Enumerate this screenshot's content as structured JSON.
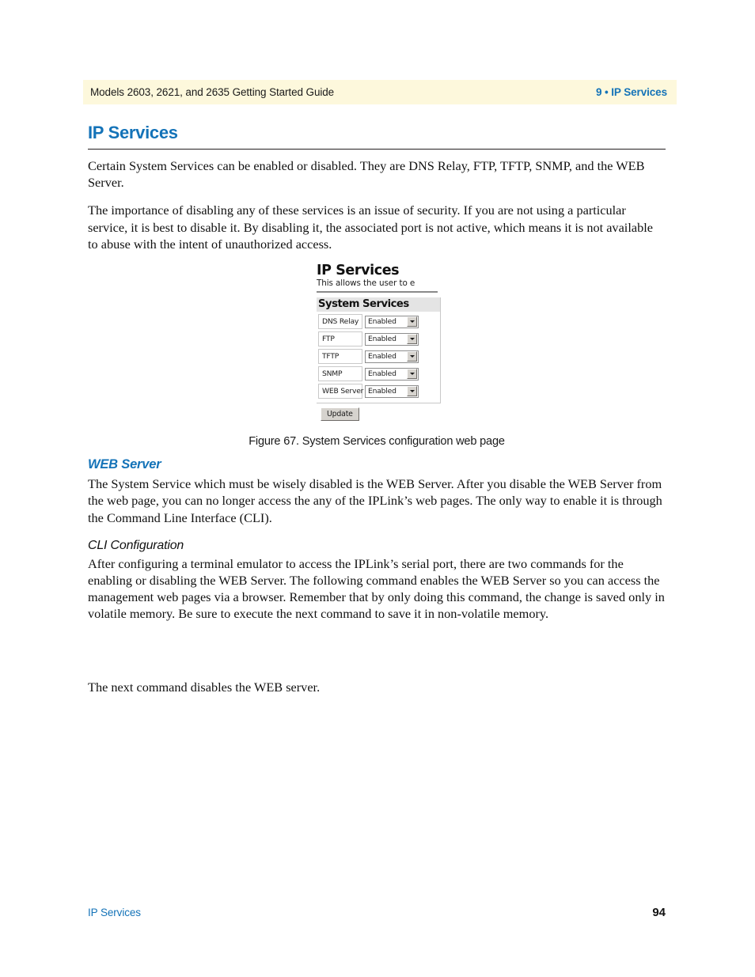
{
  "header": {
    "left_text": "Models 2603, 2621, and 2635 Getting Started Guide",
    "right_text": "9 • IP Services",
    "band_color": "#fdf8dc",
    "accent_color": "#1473b8"
  },
  "page": {
    "title": "IP Services",
    "paragraphs": [
      "Certain System Services can be enabled or disabled. They are DNS Relay, FTP, TFTP, SNMP, and the WEB Server.",
      "The importance of disabling any of these services is an issue of security. If you are not using a particular service, it is best to disable it. By disabling it, the associated port is not active, which means it is not available to abuse with the intent of unauthorized access."
    ]
  },
  "figure": {
    "screenshot": {
      "title": "IP Services",
      "subtitle": "This allows the user to e",
      "panel_heading": "System Services",
      "rows": [
        {
          "label": "DNS Relay",
          "value": "Enabled"
        },
        {
          "label": "FTP",
          "value": "Enabled"
        },
        {
          "label": "TFTP",
          "value": "Enabled"
        },
        {
          "label": "SNMP",
          "value": "Enabled"
        },
        {
          "label": "WEB Server",
          "value": "Enabled"
        }
      ],
      "update_label": "Update"
    },
    "caption": "Figure 67. System Services configuration web page"
  },
  "web_server_section": {
    "heading": "WEB Server",
    "body": "The System Service which must be wisely disabled is the WEB Server. After you disable the WEB Server from the web page, you can no longer access the any of the IPLink’s web pages. The only way to enable it is through the Command Line Interface (CLI)."
  },
  "cli_section": {
    "heading": "CLI Configuration",
    "body": "After configuring a terminal emulator to access the IPLink’s serial port, there are two commands for the enabling or disabling the WEB Server. The following command enables the WEB Server so you can access the management web pages via a browser. Remember that by only doing this command, the change is saved only in volatile memory. Be sure to execute the next command to save it in non-volatile memory.",
    "closing_line": "The next command disables the WEB server."
  },
  "footer": {
    "left_text": "IP Services",
    "page_number": "94"
  }
}
